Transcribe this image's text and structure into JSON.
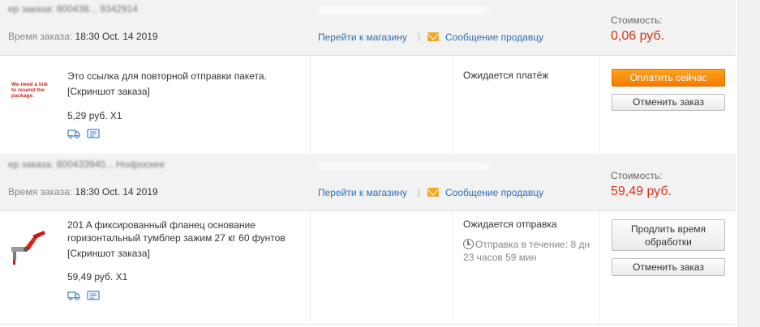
{
  "orders": [
    {
      "number_blurred": "ер заказа: 800438... 9342914",
      "time_label": "Время заказа:",
      "time_value": "18:30 Oct. 14 2019",
      "store_link": "Перейти к магазину",
      "separator": "|",
      "message_link": "Сообщение продавцу",
      "cost_label": "Стоимость:",
      "cost_value": "0,06 руб.",
      "thumb_text": "We need a link to resend the package.",
      "product_title": "Это ссылка для повторной отправки пакета.",
      "snapshot_link": "[Скриншот заказа]",
      "price_qty": "5,29 руб. X1",
      "status": "Ожидается платёж",
      "primary_button": "Оплатить сейчас",
      "secondary_button": "Отменить заказ"
    },
    {
      "number_blurred": "ер заказа: 800433940... Hodpocкee",
      "time_label": "Время заказа:",
      "time_value": "18:30 Oct. 14 2019",
      "store_link": "Перейти к магазину",
      "separator": "|",
      "message_link": "Сообщение продавцу",
      "cost_label": "Стоимость:",
      "cost_value": "59,49 руб.",
      "product_title": "201 A фиксированный фланец основание горизонтальный тумблер зажим 27 кг 60 фунтов",
      "snapshot_link": "[Скриншот заказа]",
      "price_qty": "59,49 руб. X1",
      "status": "Ожидается отправка",
      "ship_time": "Отправка в течение: 8 дн 23 часов 59 мин",
      "primary_button": "Продлить время обработки",
      "secondary_button": "Отменить заказ"
    }
  ],
  "colors": {
    "link": "#2a6ebb",
    "price": "#d2341a",
    "pay_button": "#f47b00",
    "header_bg": "#f2f2f2"
  },
  "icons": [
    "truck-icon",
    "snapshot-card-icon",
    "mail-icon",
    "clock-icon"
  ]
}
